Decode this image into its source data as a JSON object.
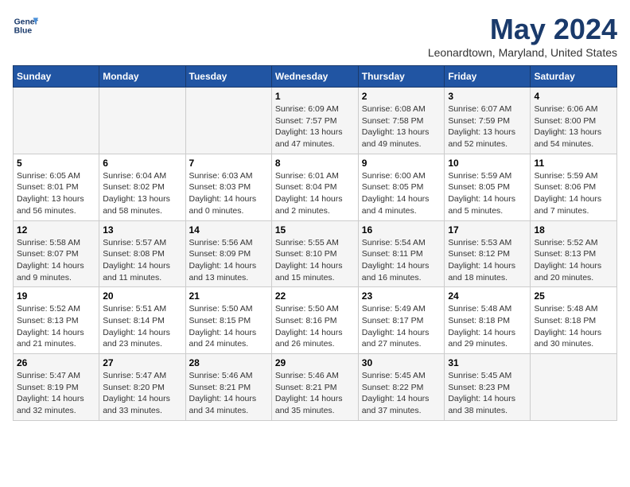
{
  "header": {
    "logo_line1": "General",
    "logo_line2": "Blue",
    "month": "May 2024",
    "location": "Leonardtown, Maryland, United States"
  },
  "days_of_week": [
    "Sunday",
    "Monday",
    "Tuesday",
    "Wednesday",
    "Thursday",
    "Friday",
    "Saturday"
  ],
  "weeks": [
    [
      {
        "day": "",
        "info": ""
      },
      {
        "day": "",
        "info": ""
      },
      {
        "day": "",
        "info": ""
      },
      {
        "day": "1",
        "info": "Sunrise: 6:09 AM\nSunset: 7:57 PM\nDaylight: 13 hours\nand 47 minutes."
      },
      {
        "day": "2",
        "info": "Sunrise: 6:08 AM\nSunset: 7:58 PM\nDaylight: 13 hours\nand 49 minutes."
      },
      {
        "day": "3",
        "info": "Sunrise: 6:07 AM\nSunset: 7:59 PM\nDaylight: 13 hours\nand 52 minutes."
      },
      {
        "day": "4",
        "info": "Sunrise: 6:06 AM\nSunset: 8:00 PM\nDaylight: 13 hours\nand 54 minutes."
      }
    ],
    [
      {
        "day": "5",
        "info": "Sunrise: 6:05 AM\nSunset: 8:01 PM\nDaylight: 13 hours\nand 56 minutes."
      },
      {
        "day": "6",
        "info": "Sunrise: 6:04 AM\nSunset: 8:02 PM\nDaylight: 13 hours\nand 58 minutes."
      },
      {
        "day": "7",
        "info": "Sunrise: 6:03 AM\nSunset: 8:03 PM\nDaylight: 14 hours\nand 0 minutes."
      },
      {
        "day": "8",
        "info": "Sunrise: 6:01 AM\nSunset: 8:04 PM\nDaylight: 14 hours\nand 2 minutes."
      },
      {
        "day": "9",
        "info": "Sunrise: 6:00 AM\nSunset: 8:05 PM\nDaylight: 14 hours\nand 4 minutes."
      },
      {
        "day": "10",
        "info": "Sunrise: 5:59 AM\nSunset: 8:05 PM\nDaylight: 14 hours\nand 5 minutes."
      },
      {
        "day": "11",
        "info": "Sunrise: 5:59 AM\nSunset: 8:06 PM\nDaylight: 14 hours\nand 7 minutes."
      }
    ],
    [
      {
        "day": "12",
        "info": "Sunrise: 5:58 AM\nSunset: 8:07 PM\nDaylight: 14 hours\nand 9 minutes."
      },
      {
        "day": "13",
        "info": "Sunrise: 5:57 AM\nSunset: 8:08 PM\nDaylight: 14 hours\nand 11 minutes."
      },
      {
        "day": "14",
        "info": "Sunrise: 5:56 AM\nSunset: 8:09 PM\nDaylight: 14 hours\nand 13 minutes."
      },
      {
        "day": "15",
        "info": "Sunrise: 5:55 AM\nSunset: 8:10 PM\nDaylight: 14 hours\nand 15 minutes."
      },
      {
        "day": "16",
        "info": "Sunrise: 5:54 AM\nSunset: 8:11 PM\nDaylight: 14 hours\nand 16 minutes."
      },
      {
        "day": "17",
        "info": "Sunrise: 5:53 AM\nSunset: 8:12 PM\nDaylight: 14 hours\nand 18 minutes."
      },
      {
        "day": "18",
        "info": "Sunrise: 5:52 AM\nSunset: 8:13 PM\nDaylight: 14 hours\nand 20 minutes."
      }
    ],
    [
      {
        "day": "19",
        "info": "Sunrise: 5:52 AM\nSunset: 8:13 PM\nDaylight: 14 hours\nand 21 minutes."
      },
      {
        "day": "20",
        "info": "Sunrise: 5:51 AM\nSunset: 8:14 PM\nDaylight: 14 hours\nand 23 minutes."
      },
      {
        "day": "21",
        "info": "Sunrise: 5:50 AM\nSunset: 8:15 PM\nDaylight: 14 hours\nand 24 minutes."
      },
      {
        "day": "22",
        "info": "Sunrise: 5:50 AM\nSunset: 8:16 PM\nDaylight: 14 hours\nand 26 minutes."
      },
      {
        "day": "23",
        "info": "Sunrise: 5:49 AM\nSunset: 8:17 PM\nDaylight: 14 hours\nand 27 minutes."
      },
      {
        "day": "24",
        "info": "Sunrise: 5:48 AM\nSunset: 8:18 PM\nDaylight: 14 hours\nand 29 minutes."
      },
      {
        "day": "25",
        "info": "Sunrise: 5:48 AM\nSunset: 8:18 PM\nDaylight: 14 hours\nand 30 minutes."
      }
    ],
    [
      {
        "day": "26",
        "info": "Sunrise: 5:47 AM\nSunset: 8:19 PM\nDaylight: 14 hours\nand 32 minutes."
      },
      {
        "day": "27",
        "info": "Sunrise: 5:47 AM\nSunset: 8:20 PM\nDaylight: 14 hours\nand 33 minutes."
      },
      {
        "day": "28",
        "info": "Sunrise: 5:46 AM\nSunset: 8:21 PM\nDaylight: 14 hours\nand 34 minutes."
      },
      {
        "day": "29",
        "info": "Sunrise: 5:46 AM\nSunset: 8:21 PM\nDaylight: 14 hours\nand 35 minutes."
      },
      {
        "day": "30",
        "info": "Sunrise: 5:45 AM\nSunset: 8:22 PM\nDaylight: 14 hours\nand 37 minutes."
      },
      {
        "day": "31",
        "info": "Sunrise: 5:45 AM\nSunset: 8:23 PM\nDaylight: 14 hours\nand 38 minutes."
      },
      {
        "day": "",
        "info": ""
      }
    ]
  ]
}
